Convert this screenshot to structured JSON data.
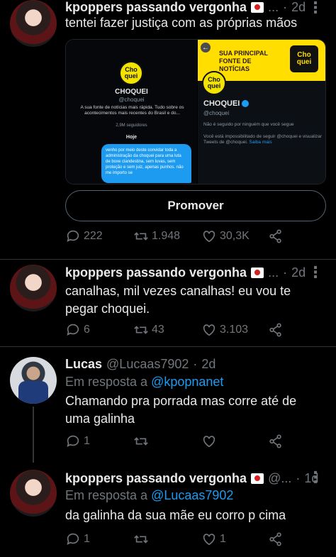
{
  "tweets": [
    {
      "name": "kpoppers passando vergonha",
      "handle": "...",
      "time": "2d",
      "text": "tentei fazer justiça com as próprias mãos",
      "promote_label": "Promover",
      "replies": "222",
      "retweets": "1.948",
      "likes": "30,3K"
    },
    {
      "name": "kpoppers passando vergonha",
      "handle": "...",
      "time": "2d",
      "text": "canalhas, mil vezes canalhas! eu vou te pegar choquei.",
      "replies": "6",
      "retweets": "43",
      "likes": "3.103"
    },
    {
      "name": "Lucas",
      "handle": "@Lucaas7902",
      "time": "2d",
      "reply_prefix": "Em resposta a",
      "reply_handle": "@kpopnanet",
      "text": "Chamando pra porrada mas corre até de uma galinha",
      "replies": "1",
      "retweets": "",
      "likes": ""
    },
    {
      "name": "kpoppers passando vergonha",
      "handle": "@...",
      "time": "1d",
      "reply_prefix": "Em resposta a",
      "reply_handle": "@Lucaas7902",
      "text": "da galinha da sua mãe eu corro p cima",
      "replies": "1",
      "retweets": "",
      "likes": "1"
    }
  ],
  "media": {
    "left_logo": "Cho quei",
    "left_name": "CHOQUEI",
    "left_handle": "@choquei",
    "left_bio": "A sua fonte de notícias mais rápida. Tudo sobre os acontecimentos mais recentes do Brasil e do...",
    "left_followers": "2,9M seguidores",
    "today": "Hoje",
    "bubble_text": "venho por meio deste convidar toda a administração da choquei para uma luta de boxe clandestina, sem luvas, sem proteção e sem juiz, apenas punhos. não me importo se",
    "banner_text": "SUA PRINCIPAL FONTE DE NOTÍCIAS",
    "banner_logo": "Cho quei",
    "right_logo": "Cho quei",
    "right_name": "CHOQUEI",
    "right_handle": "@choquei",
    "right_line1": "Não é seguido por ninguém que você segue",
    "right_line2": "Você está impossibilitado de seguir @choquei e visualizar Tweets de @choquei.",
    "right_link": "Saiba mais"
  },
  "icons": [
    "reply-icon",
    "retweet-icon",
    "like-icon",
    "share-icon",
    "more-icon",
    "verified-icon",
    "flag-icon",
    "back-arrow-icon"
  ],
  "colors": {
    "background": "#000000",
    "text": "#e7e9ea",
    "muted": "#71767b",
    "link": "#1d9bf0",
    "brand_yellow": "#ffde00"
  }
}
